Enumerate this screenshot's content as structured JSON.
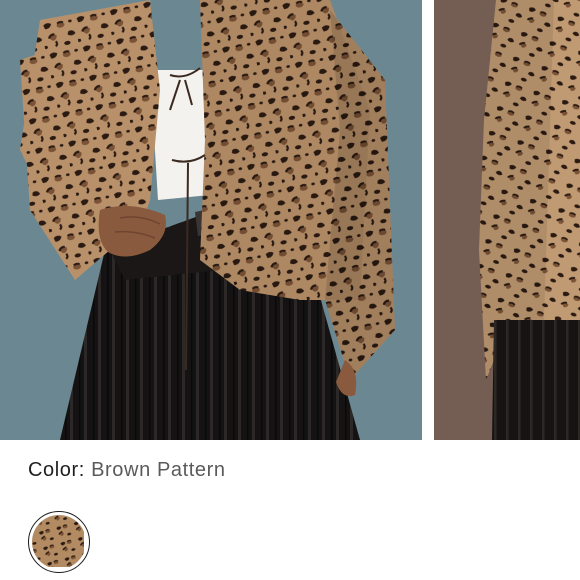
{
  "product": {
    "images": [
      {
        "icon": "leopard-jacket-model-front-photo",
        "background": "#6f8d96"
      },
      {
        "icon": "leopard-jacket-model-side-photo",
        "background": "#745d52"
      }
    ],
    "color": {
      "label": "Color:",
      "selected": "Brown Pattern"
    },
    "swatches": [
      {
        "icon": "leopard-print-swatch",
        "selected": true
      }
    ]
  },
  "colors": {
    "leopard_base": "#b8916a",
    "leopard_spot": "#2a1a12",
    "leopard_ring": "#7a5236",
    "skirt": "#141212",
    "top": "#f4f2ee"
  }
}
